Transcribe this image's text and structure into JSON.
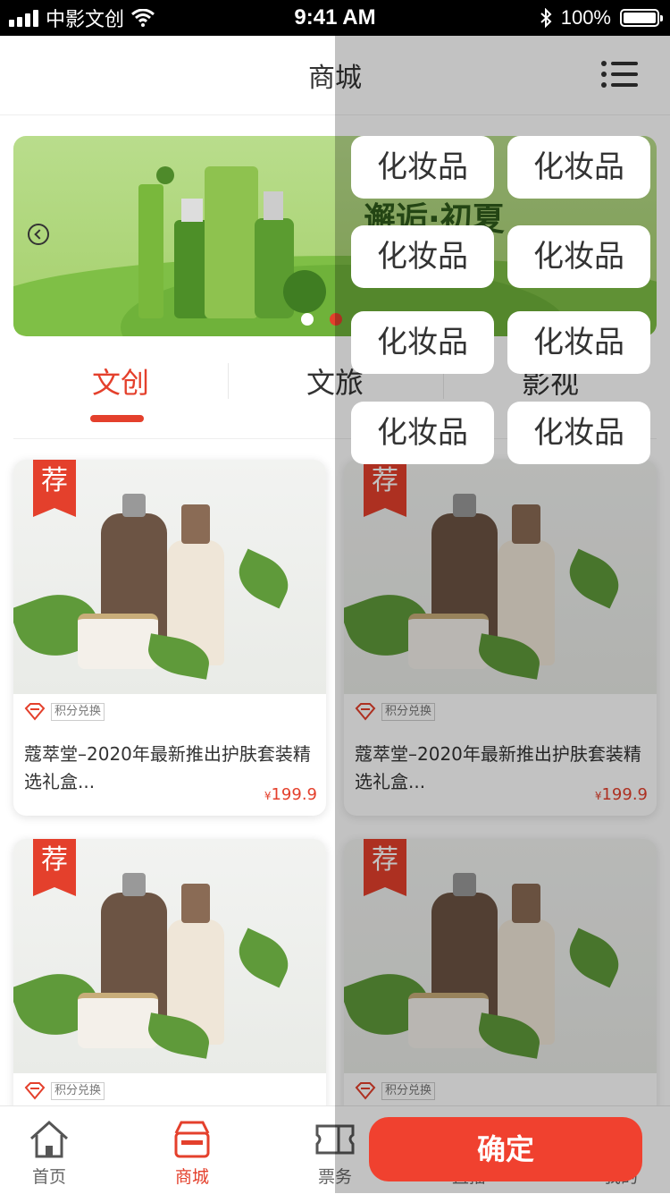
{
  "status_bar": {
    "carrier": "中影文创",
    "time": "9:41 AM",
    "battery": "100%"
  },
  "nav": {
    "title": "商城"
  },
  "banner": {
    "headline": "邂逅·初夏",
    "dots_total": 2,
    "active_dot": 2
  },
  "tabs": [
    {
      "label": "文创",
      "active": true
    },
    {
      "label": "文旅",
      "active": false
    },
    {
      "label": "影视",
      "active": false
    }
  ],
  "products": [
    {
      "badge": "荐",
      "points_label": "积分兑换",
      "title": "蔻萃堂–2020年最新推出护肤套装精选礼盒...",
      "currency": "¥",
      "price": "199.9"
    },
    {
      "badge": "荐",
      "points_label": "积分兑换",
      "title": "蔻萃堂–2020年最新推出护肤套装精选礼盒...",
      "currency": "¥",
      "price": "199.9"
    },
    {
      "badge": "荐",
      "points_label": "积分兑换"
    },
    {
      "badge": "荐",
      "points_label": "积分兑换"
    }
  ],
  "tab_bar": [
    {
      "label": "首页",
      "icon": "home-icon",
      "active": false
    },
    {
      "label": "商城",
      "icon": "shop-icon",
      "active": true
    },
    {
      "label": "票务",
      "icon": "ticket-icon",
      "active": false
    },
    {
      "label": "直播",
      "icon": "live-icon",
      "active": false
    },
    {
      "label": "我的",
      "icon": "user-icon",
      "active": false
    }
  ],
  "filter_panel": {
    "options": [
      "化妆品",
      "化妆品",
      "化妆品",
      "化妆品",
      "化妆品",
      "化妆品",
      "化妆品",
      "化妆品"
    ],
    "confirm_label": "确定"
  },
  "colors": {
    "accent": "#e4402c",
    "overlay": "rgba(0,0,0,0.24)"
  }
}
